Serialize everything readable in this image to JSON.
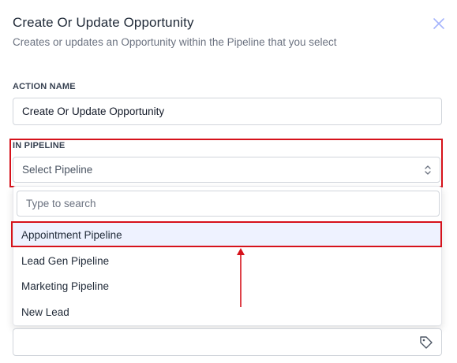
{
  "modal": {
    "title": "Create Or Update Opportunity",
    "subtitle": "Creates or updates an Opportunity within the Pipeline that you select",
    "close_icon": "close-icon"
  },
  "action_name": {
    "label": "ACTION NAME",
    "value": "Create Or Update Opportunity"
  },
  "pipeline": {
    "label": "IN PIPELINE",
    "placeholder": "Select Pipeline",
    "icon": "chevron-up-down-icon",
    "search_placeholder": "Type to search",
    "options": [
      {
        "label": "Appointment Pipeline"
      },
      {
        "label": "Lead Gen Pipeline"
      },
      {
        "label": "Marketing Pipeline"
      },
      {
        "label": "New Lead"
      }
    ]
  },
  "tag_field": {
    "value": "",
    "icon": "tag-icon"
  },
  "colors": {
    "highlight": "#d6121b",
    "annotation_arrow": "#d6121b"
  }
}
